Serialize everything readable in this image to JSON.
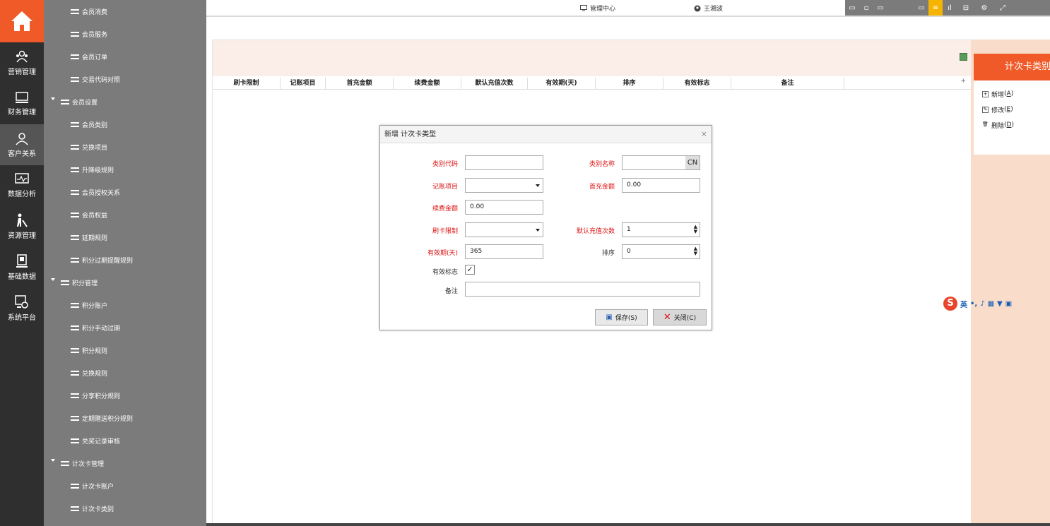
{
  "rail": {
    "items": [
      {
        "label": "营销管理"
      },
      {
        "label": "财务管理"
      },
      {
        "label": "客户关系"
      },
      {
        "label": "数据分析"
      },
      {
        "label": "资源管理"
      },
      {
        "label": "基础数据"
      },
      {
        "label": "系统平台"
      }
    ]
  },
  "tree": {
    "rows": [
      {
        "label": "会员消费",
        "type": "leaf"
      },
      {
        "label": "会员服务",
        "type": "leaf"
      },
      {
        "label": "会员订单",
        "type": "leaf"
      },
      {
        "label": "交易代码对照",
        "type": "leaf"
      },
      {
        "label": "会员设置",
        "type": "group"
      },
      {
        "label": "会员类别",
        "type": "leaf"
      },
      {
        "label": "兑换项目",
        "type": "leaf"
      },
      {
        "label": "升降级规则",
        "type": "leaf"
      },
      {
        "label": "会员授权关系",
        "type": "leaf"
      },
      {
        "label": "会员权益",
        "type": "leaf"
      },
      {
        "label": "延期规则",
        "type": "leaf"
      },
      {
        "label": "积分过期提醒规则",
        "type": "leaf"
      },
      {
        "label": "积分管理",
        "type": "group"
      },
      {
        "label": "积分账户",
        "type": "leaf"
      },
      {
        "label": "积分手动过期",
        "type": "leaf"
      },
      {
        "label": "积分规则",
        "type": "leaf"
      },
      {
        "label": "兑换规则",
        "type": "leaf"
      },
      {
        "label": "分享积分规则",
        "type": "leaf"
      },
      {
        "label": "定期赠送积分规则",
        "type": "leaf"
      },
      {
        "label": "兑奖记录审核",
        "type": "leaf"
      },
      {
        "label": "计次卡管理",
        "type": "group"
      },
      {
        "label": "计次卡账户",
        "type": "leaf"
      },
      {
        "label": "计次卡类别",
        "type": "leaf"
      }
    ]
  },
  "header": {
    "center_label": "管理中心",
    "user_name": "王湘波"
  },
  "grid": {
    "columns": [
      "刷卡限制",
      "记账项目",
      "首充金额",
      "续费金额",
      "默认充值次数",
      "有效期(天)",
      "排序",
      "有效标志",
      "备注"
    ],
    "plus": "+"
  },
  "right_panel": {
    "title": "计次卡类别",
    "actions": [
      {
        "label": "新增",
        "key": "A"
      },
      {
        "label": "修改",
        "key": "E"
      },
      {
        "label": "删除",
        "key": "D"
      }
    ]
  },
  "ime": {
    "logo": "S",
    "lang": "英"
  },
  "dialog": {
    "title": "新增 计次卡类型",
    "close": "×",
    "fields": {
      "code_label": "类别代码",
      "code_value": "",
      "name_label": "类别名称",
      "name_value": "",
      "name_btn": "CN",
      "account_label": "记账项目",
      "account_value": "",
      "first_amount_label": "首充金额",
      "first_amount_value": "0.00",
      "renew_amount_label": "续费金额",
      "renew_amount_value": "0.00",
      "swipe_limit_label": "刷卡限制",
      "swipe_limit_value": "",
      "default_count_label": "默认充值次数",
      "default_count_value": "1",
      "valid_days_label": "有效期(天)",
      "valid_days_value": "365",
      "sort_label": "排序",
      "sort_value": "0",
      "active_label": "有效标志",
      "active_checked": true,
      "remark_label": "备注",
      "remark_value": ""
    },
    "save_label": "保存(S)",
    "close_label": "关闭(C)"
  },
  "colors": {
    "accent": "#f05a28",
    "rail_bg": "#2f2f2f",
    "tree_bg": "#7b7b7b",
    "required": "#d11111",
    "toolbar_highlight": "#f5b400"
  }
}
